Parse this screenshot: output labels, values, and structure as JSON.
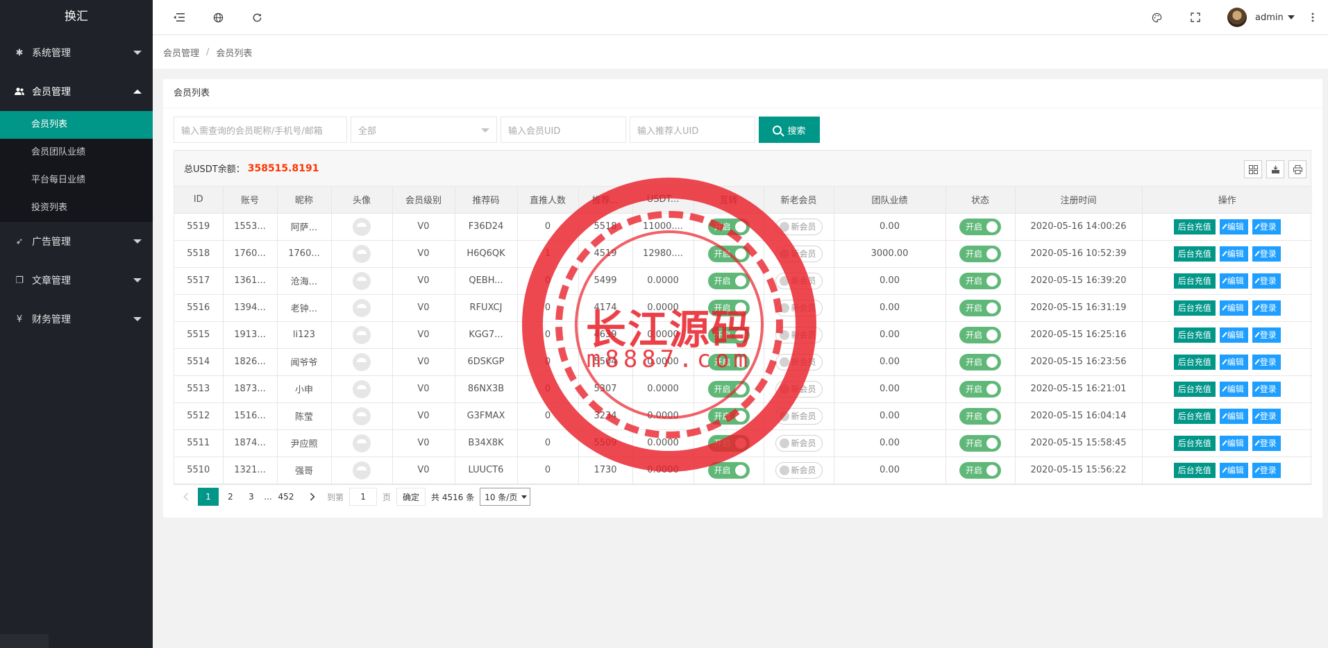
{
  "app": {
    "title": "换汇"
  },
  "sidebar": {
    "items": [
      {
        "label": "系统管理",
        "icon": "gear-icon",
        "open": false
      },
      {
        "label": "会员管理",
        "icon": "users-icon",
        "open": true,
        "children": [
          {
            "label": "会员列表",
            "active": true
          },
          {
            "label": "会员团队业绩",
            "active": false
          },
          {
            "label": "平台每日业绩",
            "active": false
          },
          {
            "label": "投资列表",
            "active": false
          }
        ]
      },
      {
        "label": "广告管理",
        "icon": "rocket-icon",
        "open": false
      },
      {
        "label": "文章管理",
        "icon": "copy-icon",
        "open": false
      },
      {
        "label": "财务管理",
        "icon": "yen-icon",
        "open": false
      }
    ]
  },
  "header": {
    "user": "admin",
    "icons": [
      "menu-fold-icon",
      "globe-icon",
      "refresh-icon",
      "theme-icon",
      "fullscreen-icon",
      "more-icon"
    ]
  },
  "breadcrumb": {
    "parent": "会员管理",
    "sep": "/",
    "current": "会员列表"
  },
  "card": {
    "title": "会员列表"
  },
  "filters": {
    "keyword_placeholder": "输入需查询的会员昵称/手机号/邮箱",
    "level_value": "全部",
    "uid_placeholder": "输入会员UID",
    "ref_placeholder": "输入推荐人UID",
    "search_label": "搜索"
  },
  "summary": {
    "label": "总USDT余额：",
    "value": "358515.8191"
  },
  "table": {
    "headers": [
      "ID",
      "账号",
      "昵称",
      "头像",
      "会员级别",
      "推荐码",
      "直推人数",
      "推荐...",
      "USDT...",
      "互转",
      "新老会员",
      "团队业绩",
      "状态",
      "注册时间",
      "操作"
    ],
    "switch_on": "开启",
    "switch_off": "新会员",
    "actions": {
      "recharge": "后台充值",
      "edit": "编辑",
      "login": "登录"
    },
    "rows": [
      {
        "id": "5519",
        "account": "1553...",
        "nick": "阿萨...",
        "level": "V0",
        "code": "F36D24",
        "direct": "0",
        "refs": "5518",
        "usdt": "11000....",
        "team": "0.00",
        "time": "2020-05-16 14:00:26"
      },
      {
        "id": "5518",
        "account": "1760...",
        "nick": "1760...",
        "level": "V0",
        "code": "H6Q6QK",
        "direct": "1",
        "refs": "4519",
        "usdt": "12980....",
        "team": "3000.00",
        "time": "2020-05-16 10:52:39"
      },
      {
        "id": "5517",
        "account": "1361...",
        "nick": "沧海...",
        "level": "V0",
        "code": "QEBH...",
        "direct": "0",
        "refs": "5499",
        "usdt": "0.0000",
        "team": "0.00",
        "time": "2020-05-15 16:39:20"
      },
      {
        "id": "5516",
        "account": "1394...",
        "nick": "老钟...",
        "level": "V0",
        "code": "RFUXCJ",
        "direct": "0",
        "refs": "4174",
        "usdt": "0.0000",
        "team": "0.00",
        "time": "2020-05-15 16:31:19"
      },
      {
        "id": "5515",
        "account": "1913...",
        "nick": "li123",
        "level": "V0",
        "code": "KGG7...",
        "direct": "0",
        "refs": "4639",
        "usdt": "0.0000",
        "team": "0.00",
        "time": "2020-05-15 16:25:16"
      },
      {
        "id": "5514",
        "account": "1826...",
        "nick": "闻爷爷",
        "level": "V0",
        "code": "6DSKGP",
        "direct": "0",
        "refs": "5504",
        "usdt": "0.0000",
        "team": "0.00",
        "time": "2020-05-15 16:23:56"
      },
      {
        "id": "5513",
        "account": "1873...",
        "nick": "小申",
        "level": "V0",
        "code": "86NX3B",
        "direct": "0",
        "refs": "5307",
        "usdt": "0.0000",
        "team": "0.00",
        "time": "2020-05-15 16:21:01"
      },
      {
        "id": "5512",
        "account": "1516...",
        "nick": "陈莹",
        "level": "V0",
        "code": "G3FMAX",
        "direct": "0",
        "refs": "3234",
        "usdt": "0.0000",
        "team": "0.00",
        "time": "2020-05-15 16:04:14"
      },
      {
        "id": "5511",
        "account": "1874...",
        "nick": "尹应照",
        "level": "V0",
        "code": "B34X8K",
        "direct": "0",
        "refs": "5509",
        "usdt": "0.0000",
        "team": "0.00",
        "time": "2020-05-15 15:58:45"
      },
      {
        "id": "5510",
        "account": "1321...",
        "nick": "强哥",
        "level": "V0",
        "code": "LUUCT6",
        "direct": "0",
        "refs": "1730",
        "usdt": "0.0000",
        "team": "0.00",
        "time": "2020-05-15 15:56:22"
      }
    ]
  },
  "pagination": {
    "current": "1",
    "p2": "2",
    "p3": "3",
    "ellipsis": "...",
    "last": "452",
    "goto_label": "到第",
    "goto_value": "1",
    "page_unit": "页",
    "ok_label": "确定",
    "total_text": "共 4516 条",
    "per_page": "10 条/页"
  },
  "watermark": {
    "title": "长江源码",
    "url": "m8887.com"
  },
  "colors": {
    "accent": "#009688",
    "blue": "#1e9fff",
    "switch": "#5fb878",
    "danger": "#ff3300",
    "sidebar": "#20222a"
  }
}
